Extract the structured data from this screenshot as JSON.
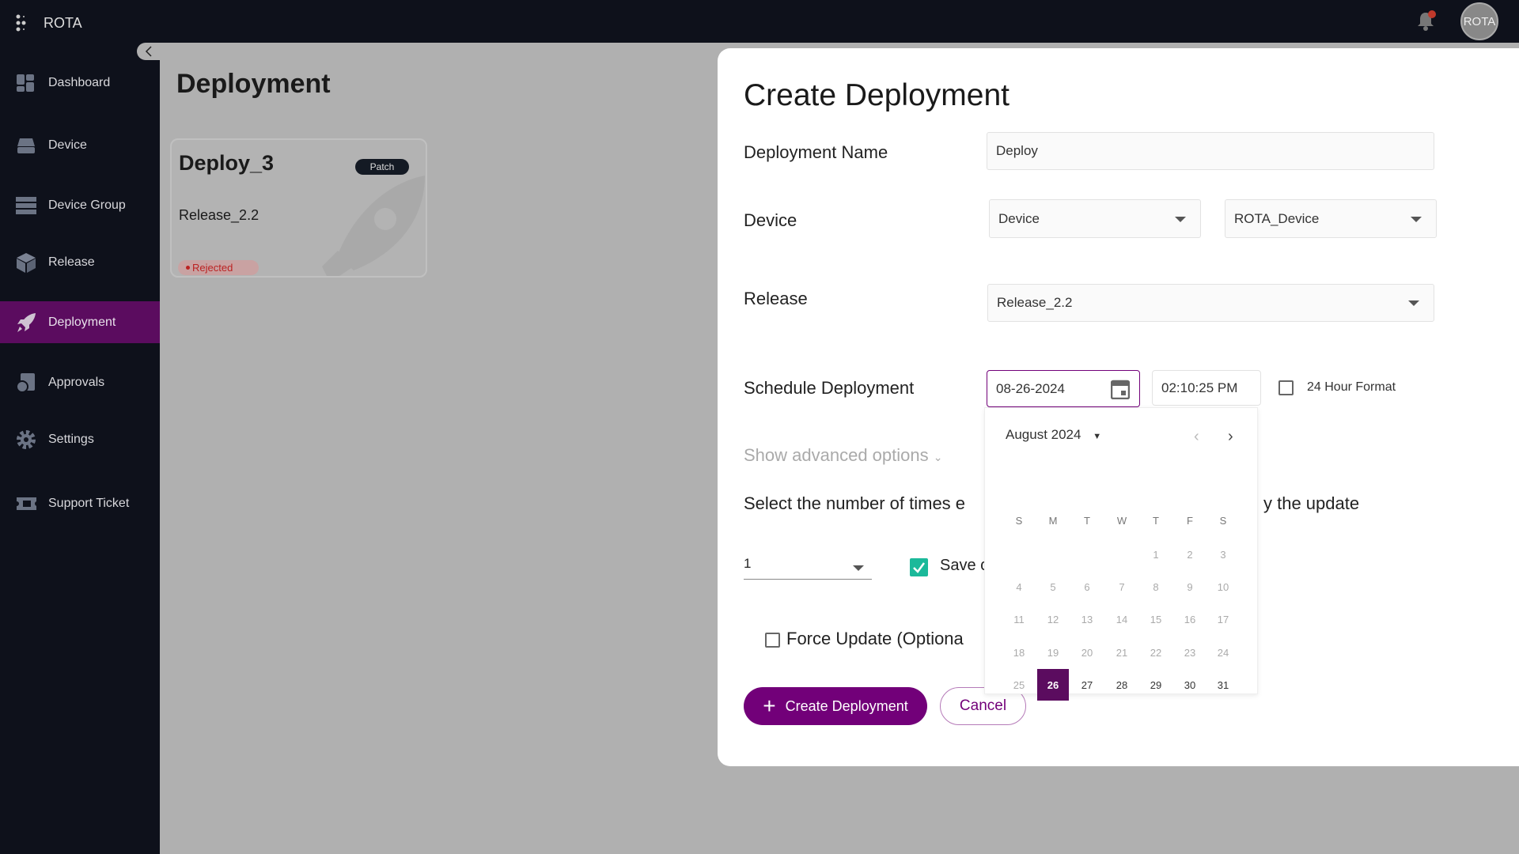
{
  "app": {
    "name": "ROTA",
    "avatar_text": "ROTA",
    "bell_icon": "bell-icon",
    "accent": "#720079"
  },
  "sidebar": {
    "items": [
      {
        "label": "Dashboard",
        "icon": "dashboard-icon"
      },
      {
        "label": "Device",
        "icon": "device-icon"
      },
      {
        "label": "Device Group",
        "icon": "device-group-icon"
      },
      {
        "label": "Release",
        "icon": "release-icon"
      },
      {
        "label": "Deployment",
        "icon": "rocket-icon",
        "active": true
      },
      {
        "label": "Approvals",
        "icon": "approvals-icon"
      },
      {
        "label": "Settings",
        "icon": "gear-icon"
      },
      {
        "label": "Support Ticket",
        "icon": "ticket-icon"
      }
    ]
  },
  "page": {
    "title": "Deployment",
    "card": {
      "name": "Deploy_3",
      "type": "Patch",
      "release": "Release_2.2",
      "status": "Rejected"
    }
  },
  "modal": {
    "title": "Create Deployment",
    "name_label": "Deployment Name",
    "name_value": "Deploy",
    "device_label": "Device",
    "device_type": "Device",
    "device_value": "ROTA_Device",
    "release_label": "Release",
    "release_value": "Release_2.2",
    "schedule_label": "Schedule Deployment",
    "date_value": "08-26-2024",
    "time_value": "02:10:25 PM",
    "hour_format_label": "24 Hour Format",
    "hour_format_checked": false,
    "advanced_label": "Show advanced options",
    "retry_text_left": "Select the number of times e",
    "retry_text_right": "y the update",
    "retry_value": "1",
    "save_label": "Save c",
    "save_checked": true,
    "force_label": "Force Update (Optiona",
    "force_checked": false,
    "create_button": "Create Deployment",
    "cancel_button": "Cancel"
  },
  "calendar": {
    "month_label": "August 2024",
    "weekdays": [
      "S",
      "M",
      "T",
      "W",
      "T",
      "F",
      "S"
    ],
    "days": [
      "1",
      "2",
      "3",
      "4",
      "5",
      "6",
      "7",
      "8",
      "9",
      "10",
      "11",
      "12",
      "13",
      "14",
      "15",
      "16",
      "17",
      "18",
      "19",
      "20",
      "21",
      "22",
      "23",
      "24",
      "25",
      "26",
      "27",
      "28",
      "29",
      "30",
      "31"
    ],
    "first_weekday": 4,
    "selected": "26"
  }
}
